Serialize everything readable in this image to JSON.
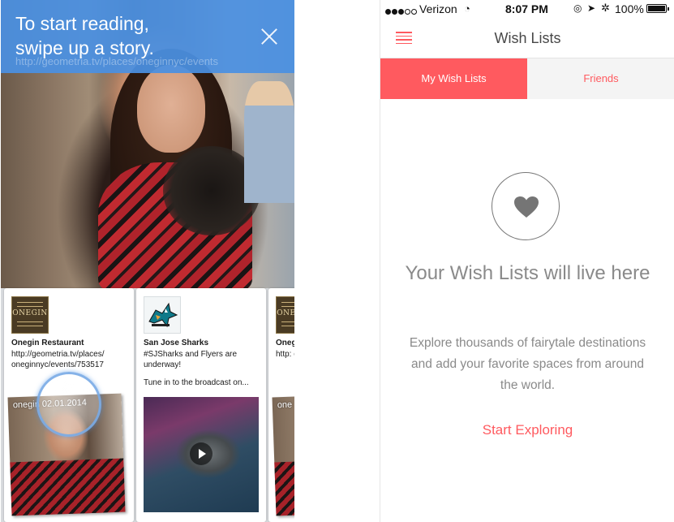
{
  "left_screen": {
    "banner": {
      "line1": "To start reading,",
      "line2": "swipe up a story.",
      "url": "http://geometria.tv/places/oneginnyc/events",
      "bg_color": "#4A90E2"
    },
    "cards": [
      {
        "logo": "ONEGIN",
        "title": "Onegin Restaurant",
        "body": "http://geometria.tv/places/ oneginnyc/events/753517",
        "body2": "",
        "photo_caption": "onegin 02.01.2014"
      },
      {
        "logo": "",
        "title": "San Jose Sharks",
        "body": "#SJSharks and Flyers are underway!",
        "body2": "Tune in to the broadcast on...",
        "photo_caption": ""
      },
      {
        "logo": "ONEGIN",
        "title": "Oneg",
        "body": "http: oneg",
        "body2": "",
        "photo_caption": "one"
      }
    ]
  },
  "right_screen": {
    "status_bar": {
      "carrier": "Verizon",
      "time": "8:07 PM",
      "battery": "100%"
    },
    "nav": {
      "title": "Wish Lists"
    },
    "tabs": [
      {
        "label": "My Wish Lists",
        "active": true
      },
      {
        "label": "Friends",
        "active": false
      }
    ],
    "empty_state": {
      "title": "Your Wish Lists will live here",
      "body": "Explore thousands of fairytale destinations and add your favorite spaces from around the world.",
      "cta": "Start Exploring"
    },
    "accent_color": "#FF5A5F"
  }
}
